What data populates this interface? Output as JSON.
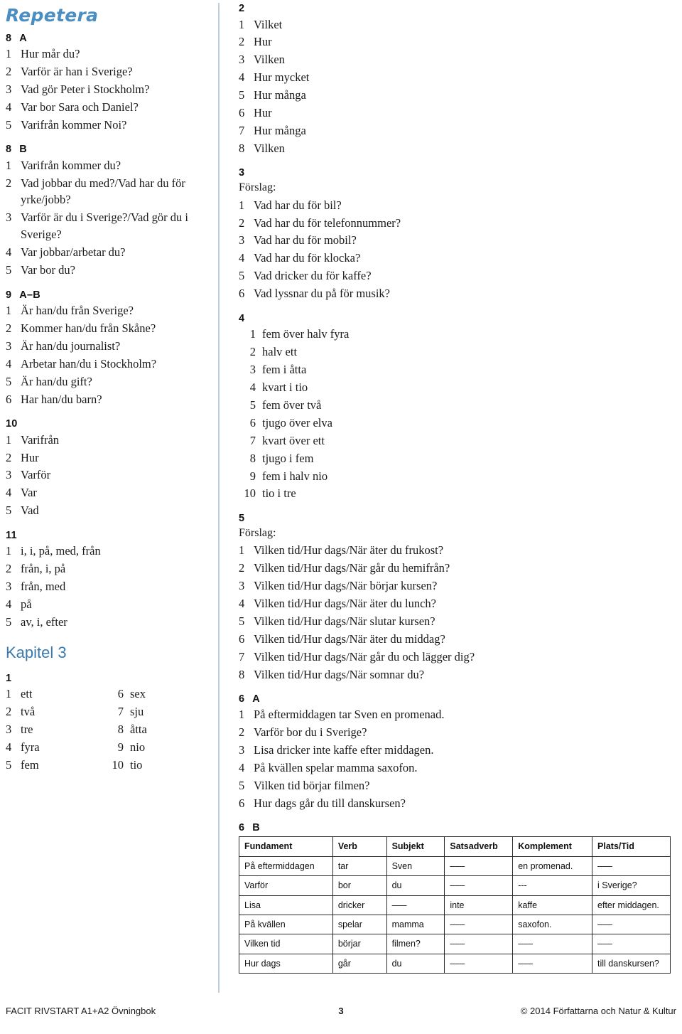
{
  "document": {
    "left_column": {
      "title": "Repetera",
      "chapter_title": "Kapitel 3",
      "sections": [
        {
          "number": "8",
          "letter": "A",
          "items": [
            "Hur mår du?",
            "Varför är han i Sverige?",
            "Vad gör Peter i Stockholm?",
            "Var bor Sara och Daniel?",
            "Varifrån kommer Noi?"
          ]
        },
        {
          "number": "8",
          "letter": "B",
          "items": [
            "Varifrån kommer du?",
            "Vad jobbar du med?/Vad har du för yrke/jobb?",
            "Varför är du i Sverige?/Vad gör du i Sverige?",
            "Var jobbar/arbetar du?",
            "Var bor du?"
          ]
        },
        {
          "number": "9",
          "letter": "A–B",
          "items": [
            "Är han/du från Sverige?",
            "Kommer han/du från Skåne?",
            "Är han/du journalist?",
            "Arbetar han/du i Stockholm?",
            "Är han/du gift?",
            "Har han/du barn?"
          ]
        },
        {
          "number": "10",
          "letter": "",
          "items": [
            "Varifrån",
            "Hur",
            "Varför",
            "Var",
            "Vad"
          ]
        },
        {
          "number": "11",
          "letter": "",
          "items": [
            "i, i, på, med, från",
            "från, i, på",
            "från, med",
            "på",
            "av, i, efter"
          ]
        }
      ],
      "chapter3_section1": {
        "number": "1",
        "left_items": [
          {
            "n": "1",
            "t": "ett"
          },
          {
            "n": "2",
            "t": "två"
          },
          {
            "n": "3",
            "t": "tre"
          },
          {
            "n": "4",
            "t": "fyra"
          },
          {
            "n": "5",
            "t": "fem"
          }
        ],
        "right_items": [
          {
            "n": "6",
            "t": "sex"
          },
          {
            "n": "7",
            "t": "sju"
          },
          {
            "n": "8",
            "t": "åtta"
          },
          {
            "n": "9",
            "t": "nio"
          },
          {
            "n": "10",
            "t": "tio"
          }
        ]
      }
    },
    "right_column": {
      "sections": [
        {
          "number": "2",
          "letter": "",
          "note": "",
          "items": [
            "Vilket",
            "Hur",
            "Vilken",
            "Hur mycket",
            "Hur många",
            "Hur",
            "Hur många",
            "Vilken"
          ]
        },
        {
          "number": "3",
          "letter": "",
          "note": "Förslag:",
          "items": [
            "Vad har du för bil?",
            "Vad har du för telefonnummer?",
            "Vad har du för mobil?",
            "Vad har du för klocka?",
            "Vad dricker du för kaffe?",
            "Vad lyssnar du på för musik?"
          ]
        },
        {
          "number": "4",
          "letter": "",
          "note": "",
          "wide_numbers": true,
          "items": [
            "fem över halv fyra",
            "halv ett",
            "fem i åtta",
            "kvart i tio",
            "fem över två",
            "tjugo över elva",
            "kvart över ett",
            "tjugo i fem",
            "fem i halv nio",
            "tio i tre"
          ]
        },
        {
          "number": "5",
          "letter": "",
          "note": "Förslag:",
          "items": [
            "Vilken tid/Hur dags/När äter du frukost?",
            "Vilken tid/Hur dags/När går du hemifrån?",
            "Vilken tid/Hur dags/När börjar kursen?",
            "Vilken tid/Hur dags/När äter du lunch?",
            "Vilken tid/Hur dags/När slutar kursen?",
            "Vilken tid/Hur dags/När äter du middag?",
            "Vilken tid/Hur dags/När går du och lägger dig?",
            "Vilken tid/Hur dags/När somnar du?"
          ]
        },
        {
          "number": "6",
          "letter": "A",
          "note": "",
          "items": [
            "På eftermiddagen tar Sven en promenad.",
            "Varför bor du i Sverige?",
            "Lisa dricker inte kaffe efter middagen.",
            "På kvällen spelar mamma saxofon.",
            "Vilken tid börjar filmen?",
            "Hur dags går du till danskursen?"
          ]
        }
      ],
      "table_section": {
        "number": "6",
        "letter": "B",
        "headers": [
          "Fundament",
          "Verb",
          "Subjekt",
          "Satsadverb",
          "Komplement",
          "Plats/Tid"
        ],
        "rows": [
          [
            "På eftermiddagen",
            "tar",
            "Sven",
            "–––",
            "en promenad.",
            "–––"
          ],
          [
            "Varför",
            "bor",
            "du",
            "–––",
            "---",
            "i Sverige?"
          ],
          [
            "Lisa",
            "dricker",
            "–––",
            "inte",
            "kaffe",
            "efter middagen."
          ],
          [
            "På kvällen",
            "spelar",
            "mamma",
            "–––",
            "saxofon.",
            "–––"
          ],
          [
            "Vilken tid",
            "börjar",
            "filmen?",
            "–––",
            "–––",
            "–––"
          ],
          [
            "Hur dags",
            "går",
            "du",
            "–––",
            "–––",
            "till danskursen?"
          ]
        ]
      }
    },
    "footer": {
      "left": "FACIT RIVSTART A1+A2 Övningbok",
      "page_number": "3",
      "right": "© 2014 Författarna och Natur & Kultur"
    },
    "colors": {
      "heading_script": "#4a8ec2",
      "heading_chapter": "#3a79ad",
      "divider": "#b9cfe0",
      "text": "#1a1a1a"
    }
  }
}
